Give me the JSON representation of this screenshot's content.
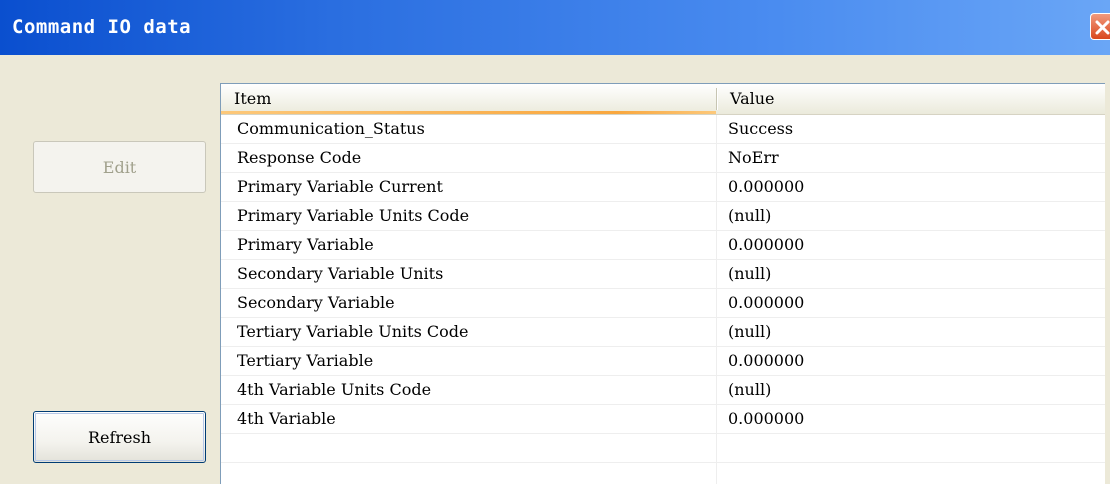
{
  "window": {
    "title": "Command IO data"
  },
  "buttons": {
    "edit_label": "Edit",
    "refresh_label": "Refresh"
  },
  "table": {
    "columns": [
      "Item",
      "Value"
    ],
    "rows": [
      {
        "item": "Communication_Status",
        "value": "Success"
      },
      {
        "item": "Response Code",
        "value": "NoErr"
      },
      {
        "item": "Primary Variable Current",
        "value": "0.000000"
      },
      {
        "item": "Primary Variable Units Code",
        "value": "(null)"
      },
      {
        "item": "Primary Variable",
        "value": "0.000000"
      },
      {
        "item": "Secondary Variable Units",
        "value": "(null)"
      },
      {
        "item": "Secondary Variable",
        "value": "0.000000"
      },
      {
        "item": "Tertiary Variable Units Code",
        "value": "(null)"
      },
      {
        "item": "Tertiary Variable",
        "value": "0.000000"
      },
      {
        "item": "4th Variable Units Code",
        "value": "(null)"
      },
      {
        "item": "4th Variable",
        "value": "0.000000"
      }
    ]
  },
  "icons": {
    "close": "close-icon"
  },
  "colors": {
    "titlebar": "#0a4fcf",
    "close_button": "#d9481e",
    "window_bg": "#ece9d8",
    "sort_highlight": "#f9a73e"
  }
}
